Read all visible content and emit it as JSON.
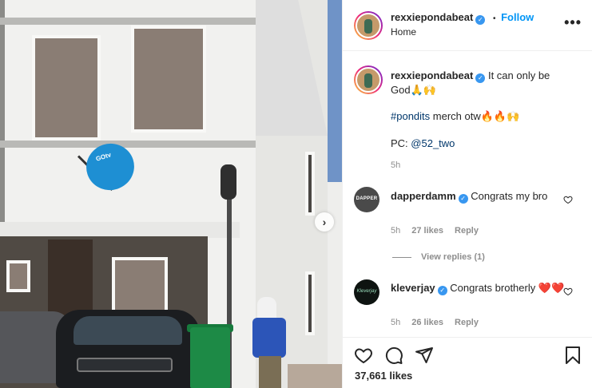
{
  "post": {
    "author": "rexxiepondabeat",
    "follow_label": "Follow",
    "bullet": "•",
    "location": "Home",
    "more_label": "•••"
  },
  "caption": {
    "username": "rexxiepondabeat",
    "line1": "It can only be God🙏🙌",
    "hashtag": "#pondits",
    "line2_rest": " merch otw🔥🔥🙌",
    "pc_label": "PC: ",
    "pc_mention": "@52_two",
    "time": "5h"
  },
  "comments": [
    {
      "username": "dapperdamm",
      "avatar_text": "DAPPER",
      "text": "Congrats my bro",
      "time": "5h",
      "likes": "27 likes",
      "reply_label": "Reply"
    },
    {
      "username": "kleverjay",
      "avatar_text": "Kleverjay",
      "text": "Congrats brotherly ❤️❤️",
      "time": "5h",
      "likes": "26 likes",
      "reply_label": "Reply"
    }
  ],
  "view_replies": "View replies (1)",
  "likes_count": "37,661 likes",
  "photo": {
    "dish_brand": "GOtv",
    "next_arrow": "›"
  }
}
